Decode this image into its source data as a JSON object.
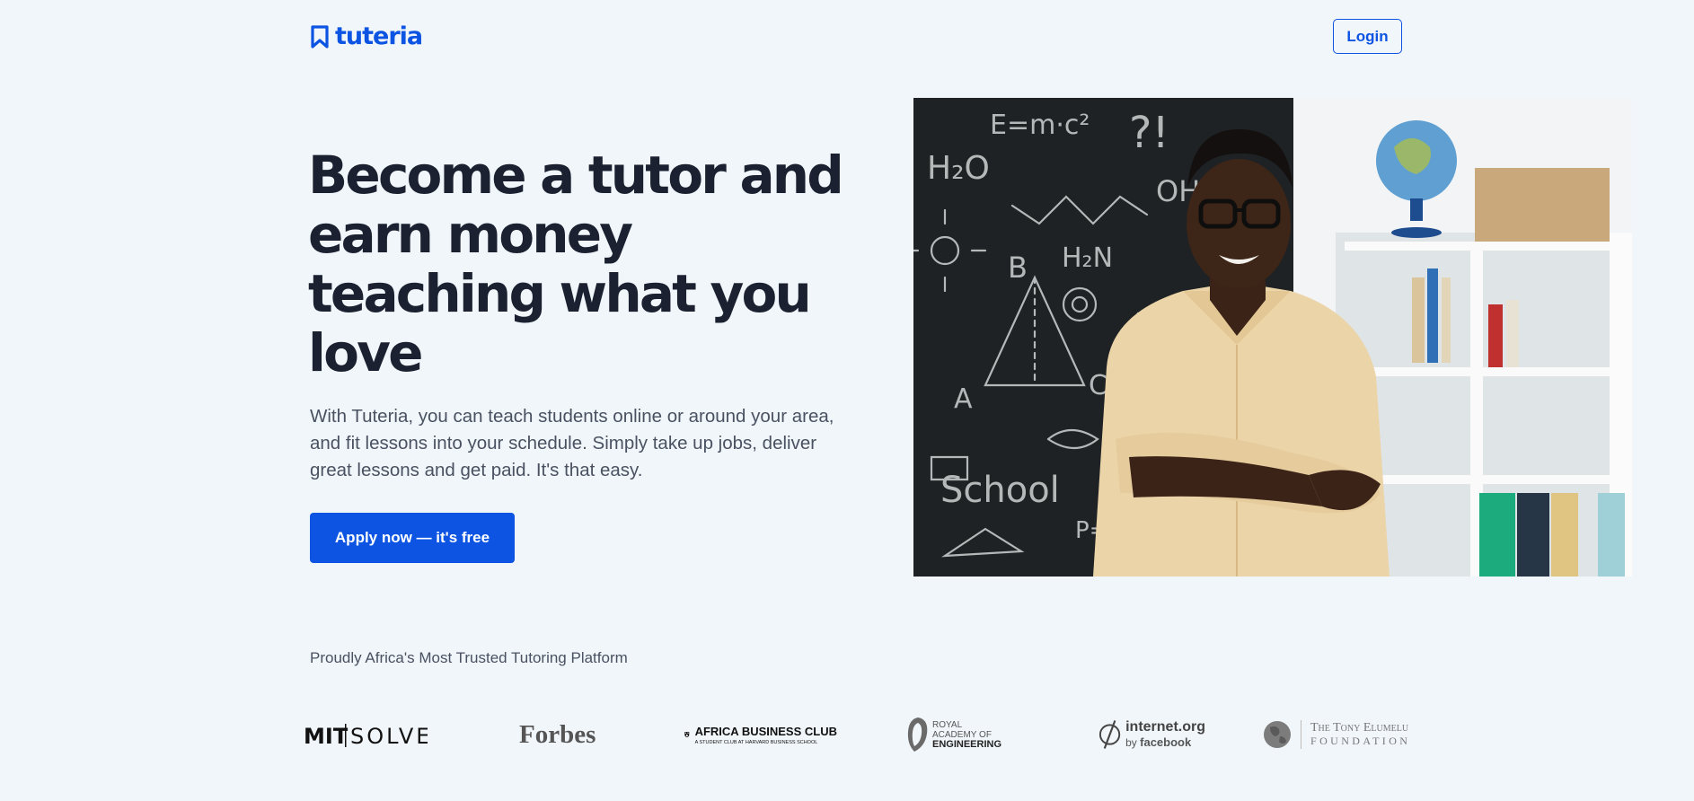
{
  "header": {
    "brand": "tuteria",
    "login_label": "Login"
  },
  "hero": {
    "headline": "Become a tutor and earn money teaching what you love",
    "subtext": "With Tuteria, you can teach students online or around your area, and fit lessons into your schedule. Simply take up jobs, deliver great lessons and get paid. It's that easy.",
    "cta_label": "Apply now — it's free",
    "image_alt": "Smiling tutor standing with arms crossed in front of a chalkboard"
  },
  "trust": {
    "title": "Proudly Africa's Most Trusted Tutoring Platform",
    "partners": {
      "mit": {
        "left": "MIT",
        "right": "SOLVE"
      },
      "forbes": {
        "name": "Forbes"
      },
      "abc": {
        "name": "AFRICA BUSINESS CLUB",
        "sub": "A STUDENT CLUB AT HARVARD BUSINESS SCHOOL"
      },
      "rae": {
        "line1": "ROYAL",
        "line2": "ACADEMY OF",
        "line3": "ENGINEERING"
      },
      "internetorg": {
        "name": "internet.org",
        "by": "by",
        "fb": "facebook"
      },
      "tef": {
        "line1": "The Tony Elumelu",
        "line2": "FOUNDATION"
      }
    }
  },
  "colors": {
    "background": "#f1f6fa",
    "brand_blue": "#0d54e3",
    "headline": "#1b2130",
    "body_text": "#4a5262"
  }
}
